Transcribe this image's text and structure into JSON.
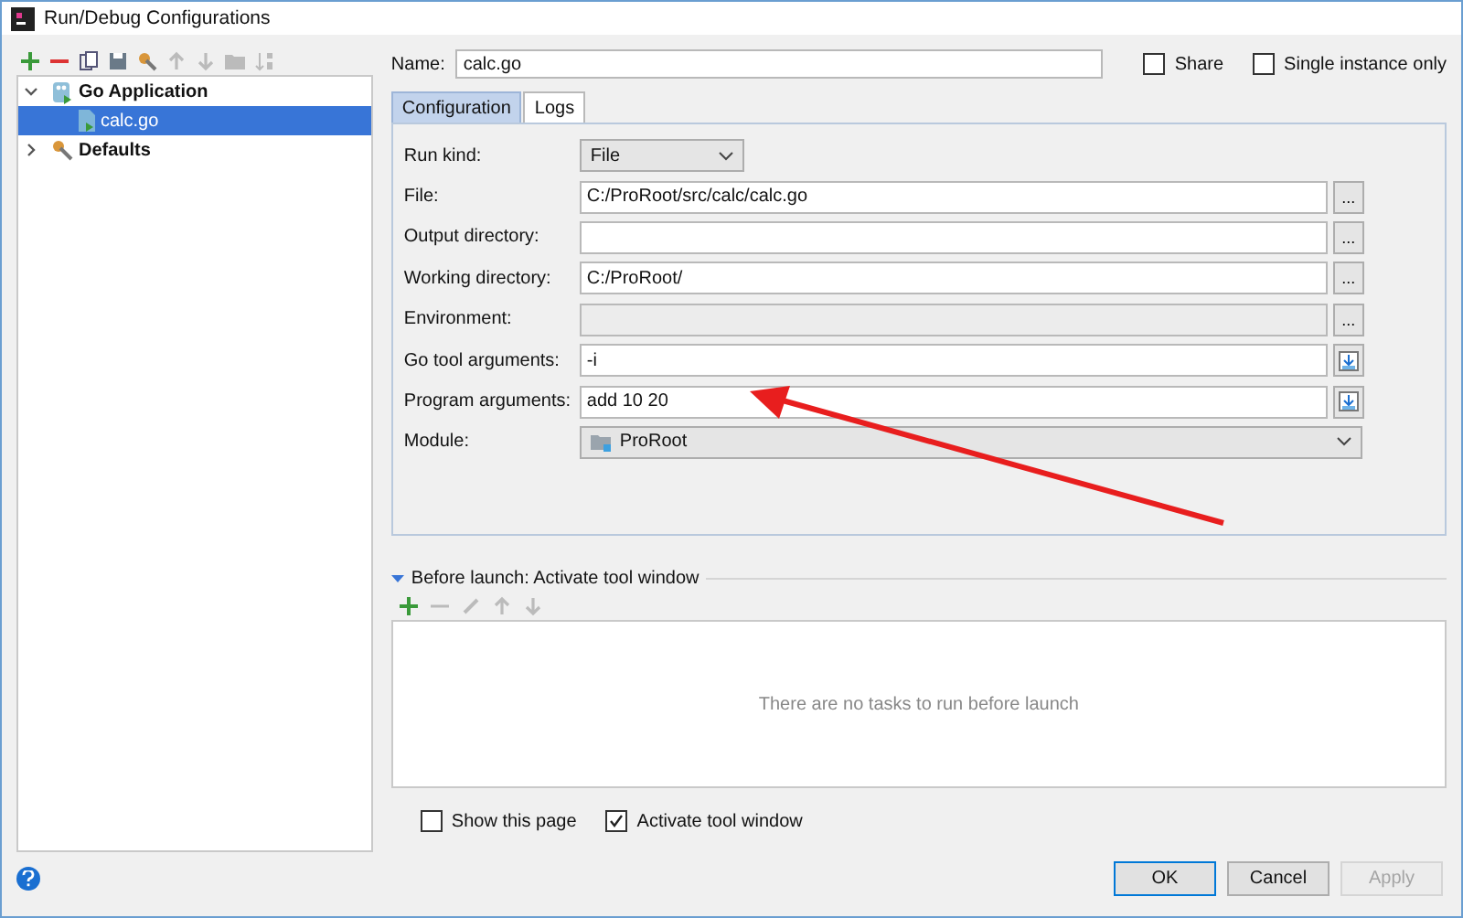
{
  "window": {
    "title": "Run/Debug Configurations"
  },
  "tree": [
    {
      "label": "Go Application",
      "expanded": true,
      "selected": false,
      "kind": "group",
      "children": [
        {
          "label": "calc.go",
          "selected": true,
          "kind": "file"
        }
      ]
    },
    {
      "label": "Defaults",
      "expanded": false,
      "selected": false,
      "kind": "defaults"
    }
  ],
  "name": {
    "label": "Name:",
    "value": "calc.go"
  },
  "share": {
    "label": "Share",
    "checked": false
  },
  "single_instance": {
    "label": "Single instance only",
    "checked": false
  },
  "tabs": [
    {
      "label": "Configuration",
      "selected": true
    },
    {
      "label": "Logs",
      "selected": false
    }
  ],
  "fields": [
    {
      "label": "Run kind:",
      "kind": "select",
      "value": "File"
    },
    {
      "label": "File:",
      "kind": "text",
      "value": "C:/ProRoot/src/calc/calc.go",
      "button": {
        "kind": "browse",
        "label": "..."
      }
    },
    {
      "label": "Output directory:",
      "kind": "text",
      "button": {
        "kind": "browse",
        "label": "..."
      }
    },
    {
      "label": "Working directory:",
      "kind": "text",
      "value": "C:/ProRoot/",
      "button": {
        "kind": "browse",
        "label": "..."
      }
    },
    {
      "label": "Environment:",
      "kind": "disabled",
      "button": {
        "kind": "browse",
        "label": "..."
      }
    },
    {
      "label": "Go tool arguments:",
      "kind": "text",
      "value": "-i",
      "button": {
        "kind": "macro"
      }
    },
    {
      "label": "Program arguments:",
      "kind": "text",
      "value": "add 10 20",
      "button": {
        "kind": "macro"
      }
    },
    {
      "label": "Module:",
      "kind": "module",
      "value": "ProRoot"
    }
  ],
  "before_launch": {
    "title": "Before launch: Activate tool window",
    "expanded": true,
    "empty_text": "There are no tasks to run before launch"
  },
  "show_page": {
    "label": "Show this page",
    "checked": false
  },
  "activate_window": {
    "label": "Activate tool window",
    "checked": true
  },
  "buttons": [
    {
      "label": "OK",
      "kind": "default",
      "disabled": false
    },
    {
      "label": "Cancel",
      "kind": "normal",
      "disabled": false
    },
    {
      "label": "Apply",
      "kind": "normal",
      "disabled": true
    }
  ]
}
